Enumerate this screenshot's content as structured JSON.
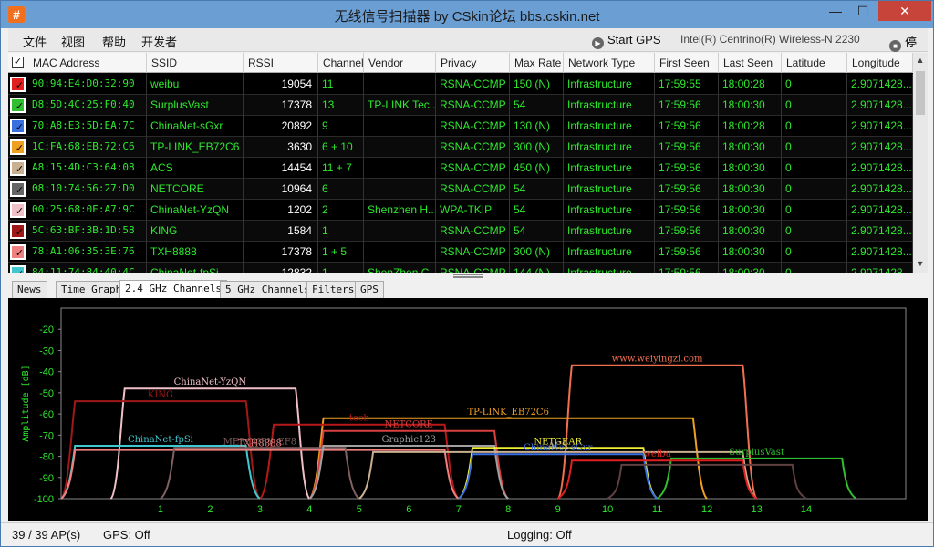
{
  "window": {
    "title": "无线信号扫描器 by CSkin论坛 bbs.cskin.net",
    "icon_glyph": "#",
    "minimize_glyph": "—",
    "maximize_glyph": "☐",
    "close_glyph": "✕"
  },
  "menu": {
    "items": [
      "文件",
      "视图",
      "帮助",
      "开发者"
    ],
    "gps_label": "Start GPS",
    "adapter": "Intel(R) Centrino(R) Wireless-N 2230",
    "stop_label": "停止"
  },
  "table": {
    "headers": [
      "MAC Address",
      "SSID",
      "RSSI",
      "Channel",
      "Vendor",
      "Privacy",
      "Max Rate",
      "Network Type",
      "First Seen",
      "Last Seen",
      "Latitude",
      "Longitude"
    ],
    "rows": [
      {
        "color": "#e02020",
        "mac": "90:94:E4:D0:32:90",
        "ssid": "weibu",
        "rssi": "19054",
        "channel": "11",
        "vendor": "",
        "privacy": "RSNA-CCMP",
        "rate": "150 (N)",
        "type": "Infrastructure",
        "first": "17:59:55",
        "last": "18:00:28",
        "lat": "0",
        "lon": "2.9071428..."
      },
      {
        "color": "#2fbf2f",
        "mac": "D8:5D:4C:25:F0:40",
        "ssid": "SurplusVast",
        "rssi": "17378",
        "channel": "13",
        "vendor": "TP-LINK Tec...",
        "privacy": "RSNA-CCMP",
        "rate": "54",
        "type": "Infrastructure",
        "first": "17:59:56",
        "last": "18:00:30",
        "lat": "0",
        "lon": "2.9071428..."
      },
      {
        "color": "#3a6fe0",
        "mac": "70:A8:E3:5D:EA:7C",
        "ssid": "ChinaNet-sGxr",
        "rssi": "20892",
        "channel": "9",
        "vendor": "",
        "privacy": "RSNA-CCMP",
        "rate": "130 (N)",
        "type": "Infrastructure",
        "first": "17:59:56",
        "last": "18:00:28",
        "lat": "0",
        "lon": "2.9071428..."
      },
      {
        "color": "#f0a020",
        "mac": "1C:FA:68:EB:72:C6",
        "ssid": "TP-LINK_EB72C6",
        "rssi": "3630",
        "channel": "6 + 10",
        "vendor": "",
        "privacy": "RSNA-CCMP",
        "rate": "300 (N)",
        "type": "Infrastructure",
        "first": "17:59:56",
        "last": "18:00:30",
        "lat": "0",
        "lon": "2.9071428..."
      },
      {
        "color": "#c8b090",
        "mac": "A8:15:4D:C3:64:08",
        "ssid": "ACS",
        "rssi": "14454",
        "channel": "11 + 7",
        "vendor": "",
        "privacy": "RSNA-CCMP",
        "rate": "450 (N)",
        "type": "Infrastructure",
        "first": "17:59:56",
        "last": "18:00:30",
        "lat": "0",
        "lon": "2.9071428..."
      },
      {
        "color": "#666666",
        "mac": "08:10:74:56:27:D0",
        "ssid": "NETCORE",
        "rssi": "10964",
        "channel": "6",
        "vendor": "",
        "privacy": "RSNA-CCMP",
        "rate": "54",
        "type": "Infrastructure",
        "first": "17:59:56",
        "last": "18:00:30",
        "lat": "0",
        "lon": "2.9071428..."
      },
      {
        "color": "#f0c0c8",
        "mac": "00:25:68:0E:A7:9C",
        "ssid": "ChinaNet-YzQN",
        "rssi": "1202",
        "channel": "2",
        "vendor": "Shenzhen H...",
        "privacy": "WPA-TKIP",
        "rate": "54",
        "type": "Infrastructure",
        "first": "17:59:56",
        "last": "18:00:30",
        "lat": "0",
        "lon": "2.9071428..."
      },
      {
        "color": "#a01818",
        "mac": "5C:63:BF:3B:1D:58",
        "ssid": "KING",
        "rssi": "1584",
        "channel": "1",
        "vendor": "",
        "privacy": "RSNA-CCMP",
        "rate": "54",
        "type": "Infrastructure",
        "first": "17:59:56",
        "last": "18:00:30",
        "lat": "0",
        "lon": "2.9071428..."
      },
      {
        "color": "#f08080",
        "mac": "78:A1:06:35:3E:76",
        "ssid": "TXH8888",
        "rssi": "17378",
        "channel": "1 + 5",
        "vendor": "",
        "privacy": "RSNA-CCMP",
        "rate": "300 (N)",
        "type": "Infrastructure",
        "first": "17:59:56",
        "last": "18:00:30",
        "lat": "0",
        "lon": "2.9071428..."
      },
      {
        "color": "#40c8d0",
        "mac": "84:11:74:84:40:4C",
        "ssid": "ChinaNet-fpSi",
        "rssi": "12832",
        "channel": "1",
        "vendor": "ShenZhen C...",
        "privacy": "RSNA-CCMP",
        "rate": "144 (N)",
        "type": "Infrastructure",
        "first": "17:59:56",
        "last": "18:00:30",
        "lat": "0",
        "lon": "2.9071428..."
      }
    ]
  },
  "tabs": [
    "News",
    "Time Graph",
    "2.4 GHz Channels",
    "5 GHz Channels",
    "Filters",
    "GPS"
  ],
  "active_tab": "2.4 GHz Channels",
  "chart_data": {
    "type": "area",
    "ylabel": "Amplitude [dB]",
    "ylim": [
      -100,
      -10
    ],
    "yticks": [
      -20,
      -30,
      -40,
      -50,
      -60,
      -70,
      -80,
      -90,
      -100
    ],
    "xticks": [
      1,
      2,
      3,
      4,
      5,
      6,
      7,
      8,
      9,
      10,
      11,
      12,
      13,
      14
    ],
    "grid": false,
    "networks": [
      {
        "name": "www.weiyingzi.com",
        "center": 11,
        "width": 4,
        "amp": -37,
        "color": "#f07050"
      },
      {
        "name": "ChinaNet-YzQN",
        "center": 2,
        "width": 4,
        "amp": -48,
        "color": "#f0c0c8"
      },
      {
        "name": "KING",
        "center": 1,
        "width": 4,
        "amp": -54,
        "color": "#a01818"
      },
      {
        "name": "TP-LINK_EB72C6",
        "center": 8,
        "width": 8,
        "amp": -62,
        "color": "#f0a020"
      },
      {
        "name": "tech",
        "center": 5,
        "width": 4,
        "amp": -65,
        "color": "#b81818"
      },
      {
        "name": "NETCORE",
        "center": 6,
        "width": 4,
        "amp": -68,
        "color": "#d84040"
      },
      {
        "name": "ChinaNet-fpSi",
        "center": 1,
        "width": 4,
        "amp": -75,
        "color": "#40c8d0"
      },
      {
        "name": "TXH8888",
        "center": 3,
        "width": 8,
        "amp": -77,
        "color": "#f08080"
      },
      {
        "name": "MERCURY_EF8",
        "center": 3,
        "width": 4,
        "amp": -76,
        "color": "#806060"
      },
      {
        "name": "Graphic123",
        "center": 6,
        "width": 4,
        "amp": -75,
        "color": "#a0a0a0"
      },
      {
        "name": "NETGEAR",
        "center": 9,
        "width": 4,
        "amp": -76,
        "color": "#f0f030"
      },
      {
        "name": "ChinaNet-sGxr",
        "center": 9,
        "width": 4,
        "amp": -79,
        "color": "#3a6fe0"
      },
      {
        "name": "ACS",
        "center": 9,
        "width": 8,
        "amp": -78,
        "color": "#c8b090"
      },
      {
        "name": "SurplusVast",
        "center": 13,
        "width": 4,
        "amp": -81,
        "color": "#2fbf2f"
      },
      {
        "name": "weibu",
        "center": 11,
        "width": 4,
        "amp": -82,
        "color": "#e02020"
      },
      {
        "name": "",
        "center": 12,
        "width": 4,
        "amp": -84,
        "color": "#604040"
      }
    ]
  },
  "status": {
    "ap_count": "39 / 39 AP(s)",
    "gps": "GPS: Off",
    "logging": "Logging: Off"
  }
}
